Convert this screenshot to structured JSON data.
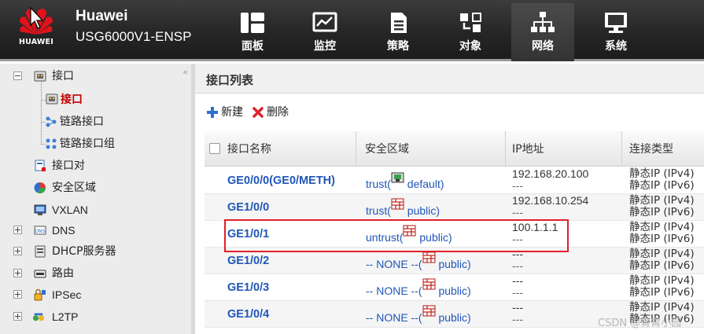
{
  "header": {
    "logo_text": "HUAWEI",
    "brand": "Huawei",
    "model": "USG6000V1-ENSP",
    "nav": [
      {
        "label": "面板",
        "icon": "dashboard-icon"
      },
      {
        "label": "监控",
        "icon": "monitor-icon"
      },
      {
        "label": "策略",
        "icon": "policy-icon"
      },
      {
        "label": "对象",
        "icon": "object-icon"
      },
      {
        "label": "网络",
        "icon": "network-icon"
      },
      {
        "label": "系统",
        "icon": "system-icon"
      }
    ],
    "active_nav": "网络"
  },
  "sidebar": {
    "collapse_glyph": "«",
    "items": [
      {
        "label": "接口",
        "icon": "interface-icon",
        "expanded": true
      },
      {
        "label": "接口",
        "icon": "interface-icon",
        "selected": true
      },
      {
        "label": "链路接口",
        "icon": "link-interface-icon"
      },
      {
        "label": "链路接口组",
        "icon": "link-interface-group-icon"
      },
      {
        "label": "接口对",
        "icon": "interface-pair-icon"
      },
      {
        "label": "安全区域",
        "icon": "security-zone-icon"
      },
      {
        "label": "VXLAN",
        "icon": "vxlan-icon"
      },
      {
        "label": "DNS",
        "icon": "dns-icon",
        "expandable": true
      },
      {
        "label": "DHCP服务器",
        "icon": "dhcp-icon",
        "expandable": true
      },
      {
        "label": "路由",
        "icon": "route-icon",
        "expandable": true
      },
      {
        "label": "IPSec",
        "icon": "ipsec-icon",
        "expandable": true
      },
      {
        "label": "L2TP",
        "icon": "l2tp-icon",
        "expandable": true
      }
    ]
  },
  "main": {
    "title": "接口列表",
    "toolbar": {
      "new_label": "新建",
      "delete_label": "删除"
    },
    "columns": [
      "接口名称",
      "安全区域",
      "IP地址",
      "连接类型"
    ],
    "rows": [
      {
        "name": "GE0/0/0(GE0/METH)",
        "zone": "trust",
        "vsys": "default",
        "zone_icon": "vsys-default-icon",
        "ip": "192.168.20.100",
        "ip6": "---",
        "type4": "静态IP (IPv4)",
        "type6": "静态IP (IPv6)"
      },
      {
        "name": "GE1/0/0",
        "zone": "trust",
        "vsys": "public",
        "zone_icon": "firewall-icon",
        "ip": "192.168.10.254",
        "ip6": "---",
        "type4": "静态IP (IPv4)",
        "type6": "静态IP (IPv6)"
      },
      {
        "name": "GE1/0/1",
        "zone": "untrust",
        "vsys": "public",
        "zone_icon": "firewall-icon",
        "ip": "100.1.1.1",
        "ip6": "---",
        "type4": "静态IP (IPv4)",
        "type6": "静态IP (IPv6)"
      },
      {
        "name": "GE1/0/2",
        "zone": "-- NONE --",
        "vsys": "public",
        "zone_icon": "firewall-icon",
        "ip": "---",
        "ip6": "---",
        "type4": "静态IP (IPv4)",
        "type6": "静态IP (IPv6)"
      },
      {
        "name": "GE1/0/3",
        "zone": "-- NONE --",
        "vsys": "public",
        "zone_icon": "firewall-icon",
        "ip": "---",
        "ip6": "---",
        "type4": "静态IP (IPv4)",
        "type6": "静态IP (IPv6)"
      },
      {
        "name": "GE1/0/4",
        "zone": "-- NONE --",
        "vsys": "public",
        "zone_icon": "firewall-icon",
        "ip": "---",
        "ip6": "---",
        "type4": "静态IP (IPv4)",
        "type6": "静态IP (IPv6)"
      }
    ]
  },
  "watermark": "CSDN @青霄小园",
  "colors": {
    "header_bg": "#262626",
    "link": "#1f56b8",
    "highlight": "#e0202a",
    "selected_text": "#c00000"
  }
}
